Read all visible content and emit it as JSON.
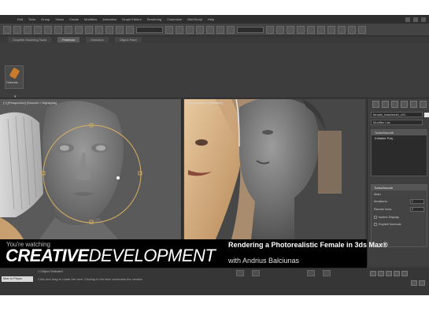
{
  "menubar": {
    "items": [
      "Edit",
      "Tools",
      "Group",
      "Views",
      "Create",
      "Modifiers",
      "Animation",
      "Graph Editors",
      "Rendering",
      "Customize",
      "MAXScript",
      "Help"
    ]
  },
  "ribbon": {
    "tabs": [
      "Graphite Modeling Tools",
      "Freeform",
      "Selection",
      "Object Paint"
    ],
    "active_tab": "Freeform",
    "tool_label": "Defaults"
  },
  "viewports": {
    "left_label": "[+] [Perspective] [Smooth + Highlights]",
    "right_label": "[+] [Camera01] [Realistic]"
  },
  "command_panel": {
    "name_field": "female_basemesh_v01",
    "modifier_list": "Modifier List",
    "stack": [
      "TurboSmooth",
      "Editable Poly"
    ],
    "rollout_title": "TurboSmooth",
    "main_label": "Main",
    "iterations_label": "Iterations:",
    "iterations_value": "1",
    "render_iters_label": "Render Iters:",
    "render_iters_value": "2",
    "isoline_label": "Isoline Display",
    "explicit_label": "Explicit Normals"
  },
  "banner": {
    "youre_watching": "You're watching",
    "brand_part1": "CREATIVE",
    "brand_part2": "DEVELOPMENT",
    "course_title": "Rendering a Photorealistic Female in 3ds Max®",
    "author": "with Andrius Balciunas"
  },
  "status": {
    "maxscript_label": "Max to Physc",
    "line1": "1 Object Selected",
    "line2": "Click and drag to rotate the view.  Clicking in the tabs constrains the rotation"
  },
  "colors": {
    "frame_bg": "#3b3b3b",
    "banner_bg": "#000000",
    "selection_ring": "#d8b060"
  }
}
